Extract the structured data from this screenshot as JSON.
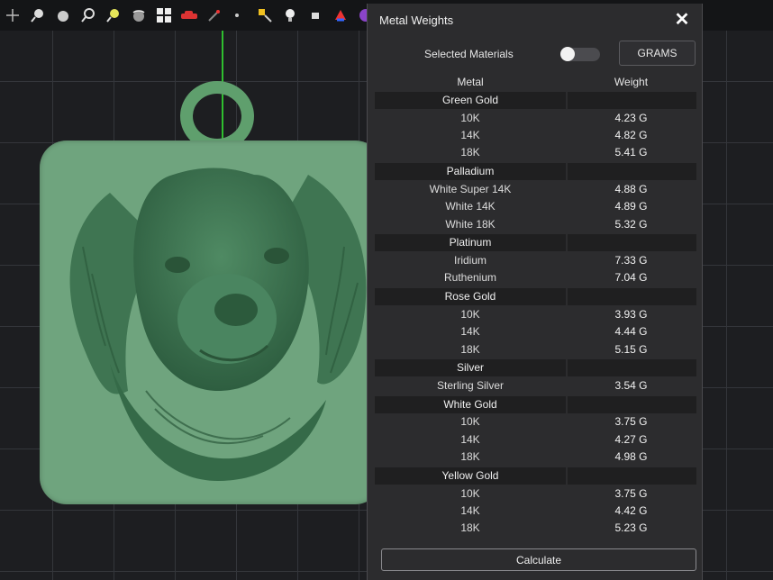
{
  "toolbar": {
    "icons": [
      "move-icon",
      "zoom-icon",
      "sphere-icon",
      "zoom-fit-icon",
      "zoom-select-icon",
      "orbit-icon",
      "layout-icon",
      "car-icon",
      "point-icon",
      "dot-icon",
      "snap-icon",
      "light-icon",
      "box-icon",
      "paint-icon",
      "render-icon"
    ]
  },
  "panel": {
    "title": "Metal Weights",
    "close": "✕",
    "selected_materials_label": "Selected Materials",
    "toggle_on": false,
    "units_button": "GRAMS",
    "col_metal": "Metal",
    "col_weight": "Weight",
    "groups": [
      {
        "name": "Green Gold",
        "rows": [
          [
            "10K",
            "4.23 G"
          ],
          [
            "14K",
            "4.82 G"
          ],
          [
            "18K",
            "5.41 G"
          ]
        ]
      },
      {
        "name": "Palladium",
        "rows": [
          [
            "White Super 14K",
            "4.88 G"
          ],
          [
            "White 14K",
            "4.89 G"
          ],
          [
            "White 18K",
            "5.32 G"
          ]
        ]
      },
      {
        "name": "Platinum",
        "rows": [
          [
            "Iridium",
            "7.33 G"
          ],
          [
            "Ruthenium",
            "7.04 G"
          ]
        ]
      },
      {
        "name": "Rose Gold",
        "rows": [
          [
            "10K",
            "3.93 G"
          ],
          [
            "14K",
            "4.44 G"
          ],
          [
            "18K",
            "5.15 G"
          ]
        ]
      },
      {
        "name": "Silver",
        "rows": [
          [
            "Sterling Silver",
            "3.54 G"
          ]
        ]
      },
      {
        "name": "White Gold",
        "rows": [
          [
            "10K",
            "3.75 G"
          ],
          [
            "14K",
            "4.27 G"
          ],
          [
            "18K",
            "4.98 G"
          ]
        ]
      },
      {
        "name": "Yellow Gold",
        "rows": [
          [
            "10K",
            "3.75 G"
          ],
          [
            "14K",
            "4.42 G"
          ],
          [
            "18K",
            "5.23 G"
          ]
        ]
      }
    ],
    "calculate_button": "Calculate"
  },
  "colors": {
    "model_green": "#6fa47e",
    "axis_green": "#2fbf2f",
    "panel_bg": "#2c2c2e"
  }
}
